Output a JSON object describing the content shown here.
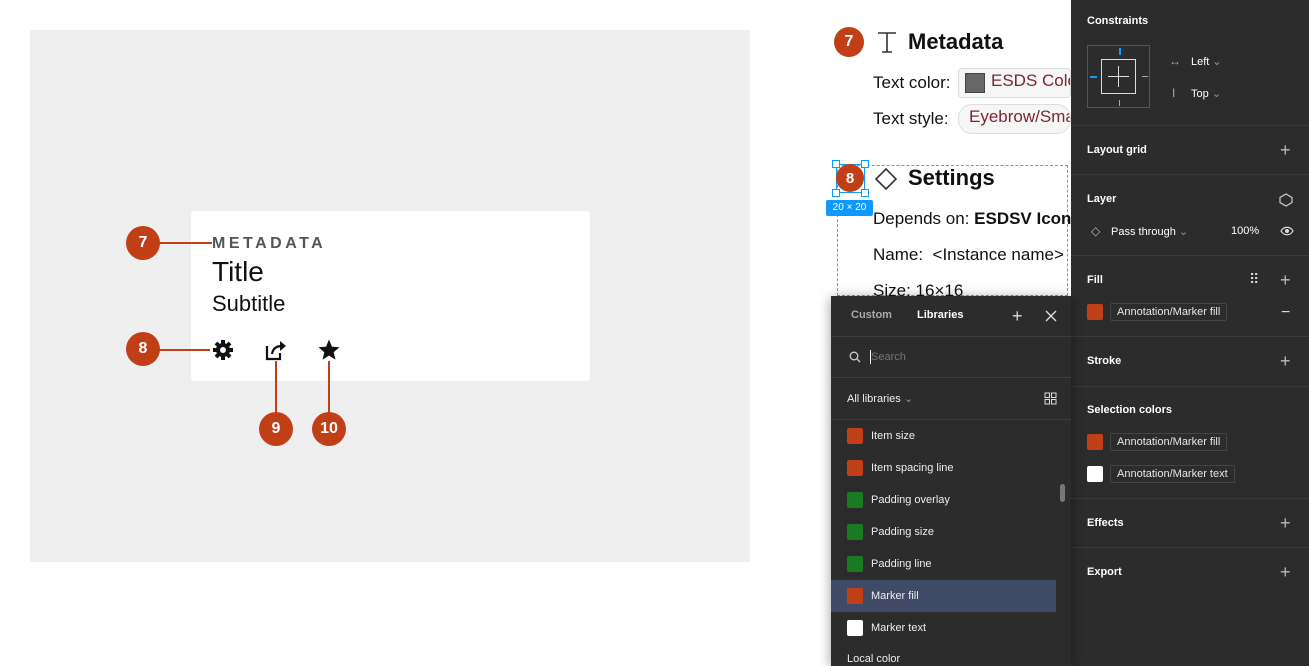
{
  "canvas": {
    "card": {
      "eyebrow": "METADATA",
      "title": "Title",
      "subtitle": "Subtitle",
      "icons": [
        "gear-icon",
        "share-icon",
        "star-icon"
      ]
    },
    "markers": [
      "7",
      "8",
      "9",
      "10"
    ]
  },
  "spec": {
    "metadata": {
      "number": "7",
      "heading": "Metadata",
      "text_color_label": "Text color:",
      "text_color_value": "ESDS Colo",
      "text_style_label": "Text style:",
      "text_style_value": "Eyebrow/Sma"
    },
    "settings": {
      "number": "8",
      "heading": "Settings",
      "size_badge": "20 × 20",
      "depends_label": "Depends on:",
      "depends_value": "ESDSV Icon",
      "name_line": "Name:  <Instance name>",
      "size_label": "Size:",
      "size_value": "16×16"
    }
  },
  "panel": {
    "constraints": {
      "title": "Constraints",
      "horizontal": "Left",
      "vertical": "Top"
    },
    "layout_grid": {
      "title": "Layout grid"
    },
    "layer": {
      "title": "Layer",
      "blend_mode": "Pass through",
      "opacity": "100%"
    },
    "fill": {
      "title": "Fill",
      "style": "Annotation/Marker fill",
      "color": "#c13f17"
    },
    "stroke": {
      "title": "Stroke"
    },
    "selection_colors": {
      "title": "Selection colors",
      "items": [
        {
          "label": "Annotation/Marker fill",
          "color": "#c13f17"
        },
        {
          "label": "Annotation/Marker text",
          "color": "#ffffff"
        }
      ]
    },
    "effects": {
      "title": "Effects"
    },
    "export": {
      "title": "Export"
    }
  },
  "popup": {
    "tabs": [
      "Custom",
      "Libraries"
    ],
    "active_tab": "Libraries",
    "search_placeholder": "Search",
    "filter": "All libraries",
    "items": [
      {
        "label": "Item size",
        "color": "#c13f17"
      },
      {
        "label": "Item spacing line",
        "color": "#c13f17"
      },
      {
        "label": "Padding overlay",
        "color": "#1a7a22"
      },
      {
        "label": "Padding size",
        "color": "#1a7a22"
      },
      {
        "label": "Padding line",
        "color": "#1a7a22"
      },
      {
        "label": "Marker fill",
        "color": "#c13f17"
      },
      {
        "label": "Marker text",
        "color": "#ffffff"
      }
    ],
    "selected_item": "Marker fill",
    "section_footer": "Local color"
  },
  "colors": {
    "marker": "#c13f17",
    "selection_blue": "#0d99ff",
    "selected_row": "#3f4b66"
  }
}
